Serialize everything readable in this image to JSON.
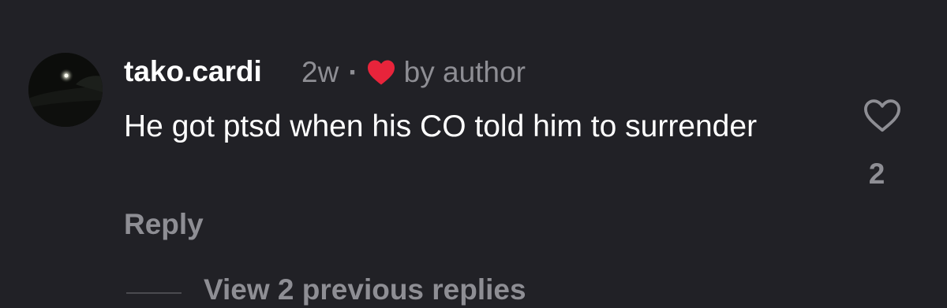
{
  "comment": {
    "username": "tako.cardi",
    "time": "2w",
    "separator": "·",
    "liked_by": "by author",
    "text": "He got ptsd when his CO told him to surrender",
    "reply_label": "Reply",
    "like_count": "2",
    "heart_color": "#e8243b"
  },
  "thread": {
    "view_previous_label": "View 2 previous replies"
  },
  "icons": {
    "liked_heart": "heart-filled-icon",
    "like_button": "heart-outline-icon"
  }
}
